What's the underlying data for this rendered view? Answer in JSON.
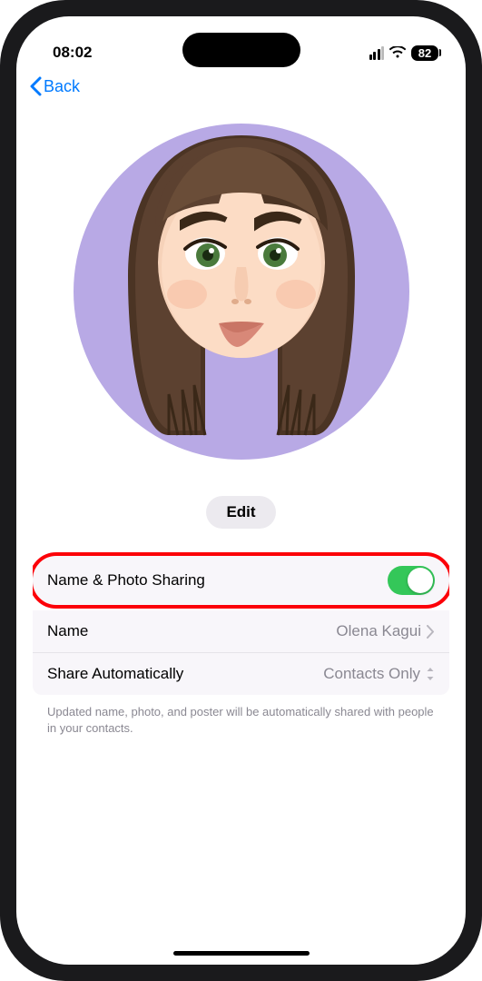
{
  "status": {
    "time": "08:02",
    "battery": "82"
  },
  "nav": {
    "back_label": "Back"
  },
  "avatar": {
    "edit_label": "Edit"
  },
  "settings": {
    "sharing_label": "Name & Photo Sharing",
    "sharing_on": true,
    "name_label": "Name",
    "name_value": "Olena Kagui",
    "share_auto_label": "Share Automatically",
    "share_auto_value": "Contacts Only",
    "footer": "Updated name, photo, and poster will be automatically shared with people in your contacts."
  }
}
